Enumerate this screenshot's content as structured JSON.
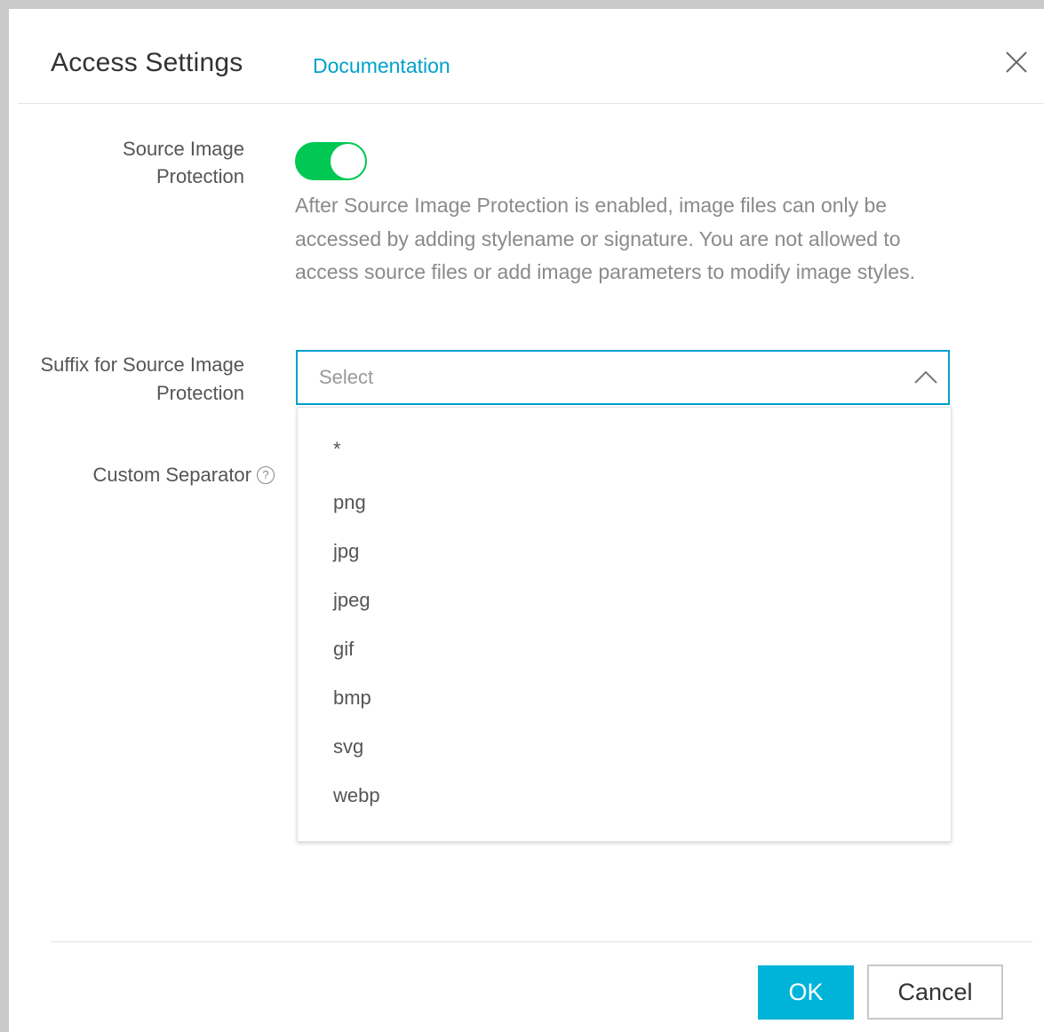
{
  "dialog": {
    "title": "Access Settings",
    "documentation_link": "Documentation"
  },
  "fields": {
    "source_protection": {
      "label": "Source Image Protection",
      "enabled": true,
      "description": "After Source Image Protection is enabled, image files can only be accessed by adding stylename or signature. You are not allowed to access source files or add image parameters to modify image styles."
    },
    "suffix": {
      "label": "Suffix for Source Image Protection",
      "placeholder": "Select",
      "options": [
        "*",
        "png",
        "jpg",
        "jpeg",
        "gif",
        "bmp",
        "svg",
        "webp"
      ]
    },
    "separator": {
      "label": "Custom Separator",
      "help_icon": "question-circle-icon"
    }
  },
  "footer": {
    "ok_label": "OK",
    "cancel_label": "Cancel"
  },
  "colors": {
    "accent": "#00a2ca",
    "toggle_on": "#00c853",
    "ok_button": "#00b4d9"
  }
}
